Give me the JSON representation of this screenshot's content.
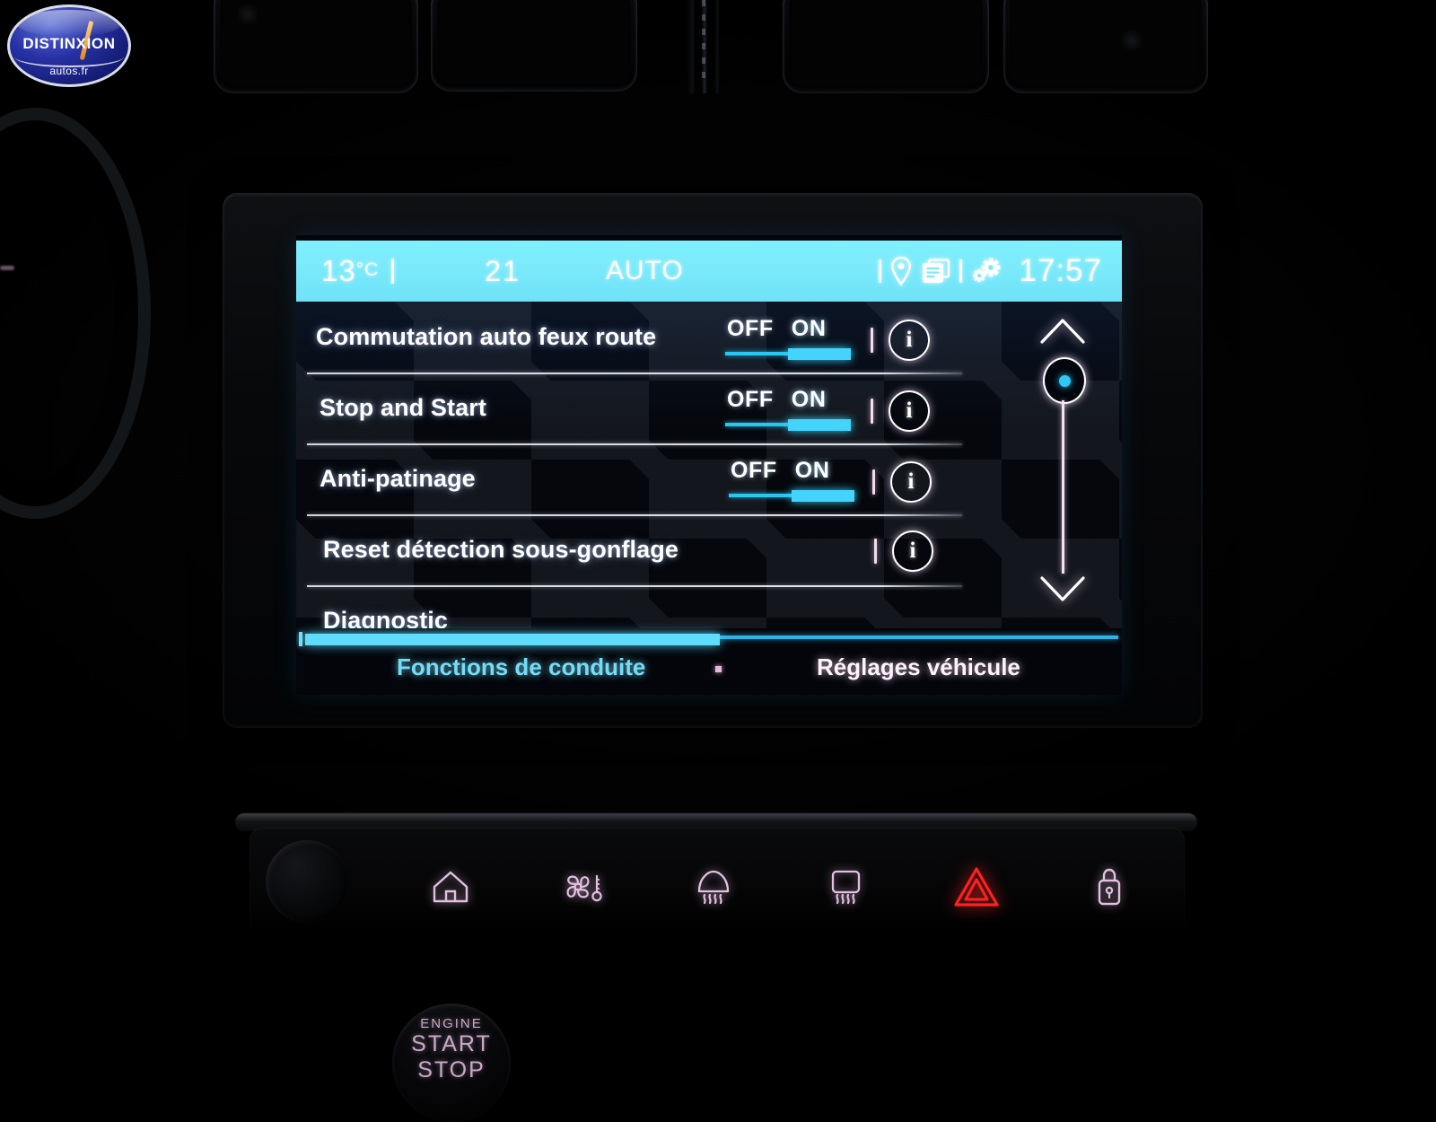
{
  "brand_logo": {
    "name": "DISTINXION",
    "subtitle": "autos.fr"
  },
  "status_bar": {
    "temperature": "13",
    "temperature_unit": "°C",
    "fan_speed": "21",
    "climate_mode": "AUTO",
    "clock": "17:57",
    "icons": [
      "location-pin-icon",
      "windows-cards-icon",
      "gears-icon"
    ],
    "background_color": "#7aeafb"
  },
  "menu": {
    "rows": [
      {
        "label": "Commutation auto feux route",
        "has_toggle": true,
        "off_label": "OFF",
        "on_label": "ON",
        "selected": "ON",
        "has_info": true
      },
      {
        "label": "Stop and Start",
        "has_toggle": true,
        "off_label": "OFF",
        "on_label": "ON",
        "selected": "ON",
        "has_info": true
      },
      {
        "label": "Anti-patinage",
        "has_toggle": true,
        "off_label": "OFF",
        "on_label": "ON",
        "selected": "ON",
        "has_info": true
      },
      {
        "label": "Reset détection sous-gonflage",
        "has_toggle": false,
        "has_info": true
      },
      {
        "label": "Diagnostic",
        "has_toggle": false,
        "has_info": false
      }
    ],
    "info_glyph": "i",
    "accent_color": "#43d3fb"
  },
  "scrollbar": {
    "up_icon": "chevron-up-icon",
    "down_icon": "chevron-down-icon",
    "thumb_position": "top",
    "thumb_dot_color": "#2ec8f5"
  },
  "tabs": {
    "active": "Fonctions de conduite",
    "inactive": "Réglages véhicule",
    "active_color": "#74dcf7",
    "inactive_color": "#fdf3fb",
    "page_indicator": "•"
  },
  "hardware_buttons": [
    {
      "icon": "home-icon",
      "color": "#e3c0e0"
    },
    {
      "icon": "climate-fan-icon",
      "color": "#e3c0e0"
    },
    {
      "icon": "front-defrost-icon",
      "color": "#e3c0e0"
    },
    {
      "icon": "rear-defrost-icon",
      "color": "#e3c0e0"
    },
    {
      "icon": "hazard-warning-icon",
      "color": "#ff2020"
    },
    {
      "icon": "door-lock-icon",
      "color": "#e3c0e0"
    }
  ],
  "engine_button": {
    "line1": "ENGINE",
    "line2": "START",
    "line3": "STOP"
  }
}
